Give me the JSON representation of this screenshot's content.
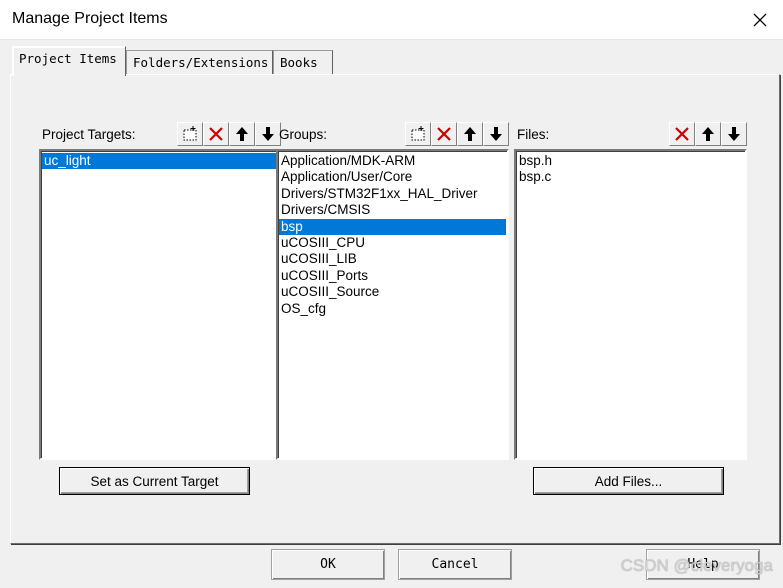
{
  "window": {
    "title": "Manage Project Items"
  },
  "tabs": [
    {
      "label": "Project Items",
      "active": true
    },
    {
      "label": "Folders/Extensions",
      "active": false
    },
    {
      "label": "Books",
      "active": false
    }
  ],
  "targets": {
    "label": "Project Targets:",
    "items": [
      {
        "text": "uc_light",
        "selected": true
      }
    ],
    "button": "Set as Current Target"
  },
  "groups": {
    "label": "Groups:",
    "items": [
      {
        "text": "Application/MDK-ARM",
        "selected": false
      },
      {
        "text": "Application/User/Core",
        "selected": false
      },
      {
        "text": "Drivers/STM32F1xx_HAL_Driver",
        "selected": false
      },
      {
        "text": "Drivers/CMSIS",
        "selected": false
      },
      {
        "text": "bsp",
        "selected": true
      },
      {
        "text": "uCOSIII_CPU",
        "selected": false
      },
      {
        "text": "uCOSIII_LIB",
        "selected": false
      },
      {
        "text": "uCOSIII_Ports",
        "selected": false
      },
      {
        "text": "uCOSIII_Source",
        "selected": false
      },
      {
        "text": "OS_cfg",
        "selected": false
      }
    ]
  },
  "files": {
    "label": "Files:",
    "items": [
      {
        "text": "bsp.h",
        "selected": false
      },
      {
        "text": "bsp.c",
        "selected": false
      }
    ],
    "button": "Add Files..."
  },
  "buttons": {
    "ok": "OK",
    "cancel": "Cancel",
    "help": "Help"
  },
  "watermark": "CSDN @cleveryoga",
  "icons": {
    "new": "new-item-icon",
    "delete": "delete-x-icon",
    "up": "move-up-arrow-icon",
    "down": "move-down-arrow-icon",
    "close": "close-icon"
  },
  "colors": {
    "selection": "#0078d7",
    "delete": "#cc0000"
  }
}
